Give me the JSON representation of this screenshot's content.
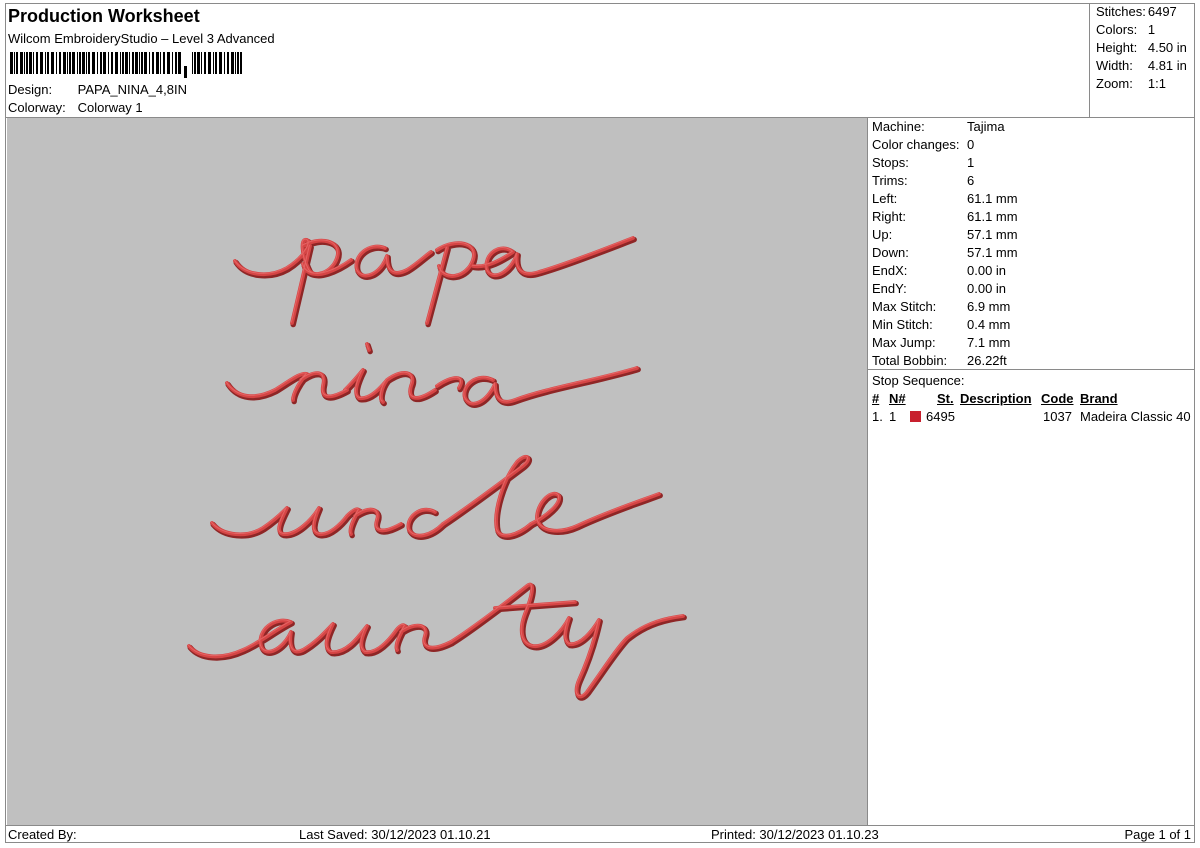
{
  "header": {
    "title": "Production Worksheet",
    "software": "Wilcom EmbroideryStudio – Level 3 Advanced",
    "design_label": "Design:",
    "design_value": "PAPA_NINA_4,8IN",
    "colorway_label": "Colorway:",
    "colorway_value": "Colorway 1"
  },
  "summary": [
    {
      "label": "Stitches:",
      "value": "6497"
    },
    {
      "label": "Colors:",
      "value": "1"
    },
    {
      "label": "Height:",
      "value": "4.50 in"
    },
    {
      "label": "Width:",
      "value": "4.81 in"
    },
    {
      "label": "Zoom:",
      "value": "1:1"
    }
  ],
  "preview": {
    "background": "#c0c0c0",
    "thread_color": "#d54545",
    "thread_shadow": "#8e2626",
    "words": [
      "papa",
      "nina",
      "uncle",
      "aunty"
    ]
  },
  "machine_info": [
    {
      "label": "Machine:",
      "value": "Tajima"
    },
    {
      "label": "Color changes:",
      "value": "0"
    },
    {
      "label": "Stops:",
      "value": "1"
    },
    {
      "label": "Trims:",
      "value": "6"
    },
    {
      "label": "Left:",
      "value": "61.1 mm"
    },
    {
      "label": "Right:",
      "value": "61.1 mm"
    },
    {
      "label": "Up:",
      "value": "57.1 mm"
    },
    {
      "label": "Down:",
      "value": "57.1 mm"
    },
    {
      "label": "EndX:",
      "value": "0.00 in"
    },
    {
      "label": "EndY:",
      "value": "0.00 in"
    },
    {
      "label": "Max Stitch:",
      "value": "6.9 mm"
    },
    {
      "label": "Min Stitch:",
      "value": "0.4 mm"
    },
    {
      "label": "Max Jump:",
      "value": "7.1 mm"
    },
    {
      "label": "Total Bobbin:",
      "value": "26.22ft"
    }
  ],
  "stop_sequence": {
    "title": "Stop Sequence:",
    "columns": [
      "#",
      "N#",
      "St.",
      "Description",
      "Code",
      "Brand"
    ],
    "rows": [
      {
        "index": "1.",
        "n": "1",
        "color": "#c8202e",
        "stitches": "6495",
        "description": "",
        "code": "1037",
        "brand": "Madeira Classic 40"
      }
    ]
  },
  "footer": {
    "created_by": "Created By:",
    "last_saved": "Last Saved: 30/12/2023 01.10.21",
    "printed": "Printed: 30/12/2023 01.10.23",
    "page": "Page 1 of 1"
  }
}
